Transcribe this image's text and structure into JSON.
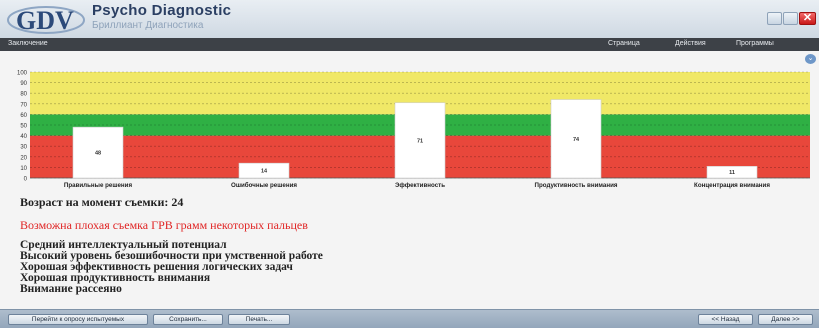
{
  "app": {
    "title": "Psycho Diagnostic",
    "subtitle": "Бриллиант Диагностика",
    "logo_text": "GDV"
  },
  "window_controls": {
    "close_glyph": "✕"
  },
  "menubar": {
    "left_label": "Заключение",
    "items": [
      "Страница",
      "Действия",
      "Программы"
    ]
  },
  "collapse_glyph": "⌄",
  "chart_data": {
    "type": "bar",
    "categories": [
      "Правильные решения",
      "Ошибочные решения",
      "Эффективность",
      "Продуктивность внимания",
      "Концентрация внимания"
    ],
    "values": [
      48,
      14,
      71,
      74,
      11
    ],
    "value_labels": [
      "48",
      "14",
      "71",
      "74",
      "11"
    ],
    "ylim": [
      0,
      100
    ],
    "yticks": [
      0,
      10,
      20,
      30,
      40,
      50,
      60,
      70,
      80,
      90,
      100
    ],
    "bands": [
      {
        "from": 0,
        "to": 40,
        "color": "#e8473b"
      },
      {
        "from": 40,
        "to": 60,
        "color": "#2fb044"
      },
      {
        "from": 60,
        "to": 100,
        "color": "#f0e867"
      }
    ],
    "bar_color": "#ffffff"
  },
  "results": {
    "age_text": "Возраст на момент съемки: 24",
    "warning_text": "Возможна плохая съемка ГРВ грамм некоторых пальцев",
    "findings": [
      "Средний интеллектуальный потенциал",
      "Высокий уровень безошибочности при умственной работе",
      "Хорошая эффективность решения логических задач",
      "Хорошая продуктивность внимания",
      "Внимание рассеяно"
    ]
  },
  "bottom_buttons": {
    "goto_tests": "Перейти к опросу испытуемых",
    "save": "Сохранить...",
    "print": "Печать...",
    "back": "<< Назад",
    "next": "Далее >>"
  }
}
